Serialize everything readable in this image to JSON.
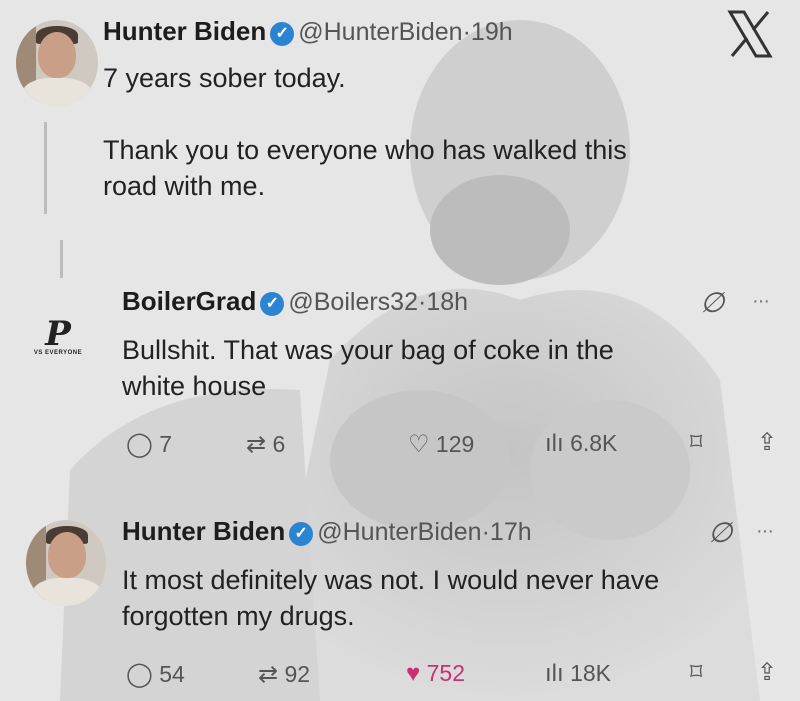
{
  "app": {
    "brand_icon": "x-logo-icon",
    "logo_text": "X"
  },
  "tweets": [
    {
      "name": "Hunter Biden",
      "handle": "@HunterBiden",
      "time": "19h",
      "text_line1": "7 years sober today.",
      "text_line2": "Thank you to everyone who has walked this",
      "text_line3": "road with me."
    },
    {
      "name": "BoilerGrad",
      "handle": "@Boilers32",
      "time": "18h",
      "text_line1": "Bullshit. That was your bag of coke in the",
      "text_line2": "white house",
      "logo_letter": "P",
      "logo_caption": "VS EVERYONE",
      "replies": "7",
      "reposts": "6",
      "likes": "129",
      "views": "6.8K"
    },
    {
      "name": "Hunter Biden",
      "handle": "@HunterBiden",
      "time": "17h",
      "text_line1": "It most definitely was not. I would never have",
      "text_line2": "forgotten my drugs.",
      "replies": "54",
      "reposts": "92",
      "likes": "752",
      "views": "18K"
    }
  ],
  "separator": "·",
  "more_glyph": "···",
  "colors": {
    "like_active": "#cc2f70",
    "verified": "#2b84d2",
    "background": "#e6e6e6"
  }
}
